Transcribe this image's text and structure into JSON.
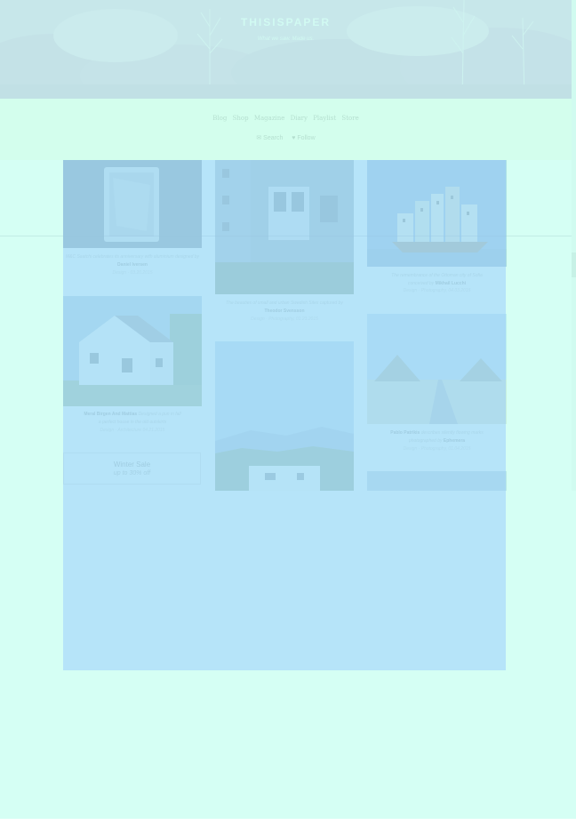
{
  "site": {
    "title": "THISISPAPER",
    "tagline": "What we saw. Made us."
  },
  "nav": {
    "links": [
      "Blog",
      "Shop",
      "Magazine",
      "Diary",
      "Playlist",
      "Store"
    ],
    "search_label": "✉ Search",
    "follow_label": "♥ Follow"
  },
  "posts": {
    "foil": {
      "caption_prefix": "M&C Saatchi celebrates its anniversary with aluminium",
      "caption_mid": "designed by",
      "author": "Daniel Iversen",
      "category": "Design",
      "date": "03.20.2015"
    },
    "building": {
      "caption_prefix": "The beauties of small and urban Swedish Sites captured by",
      "author": "Theodor Svensson",
      "category": "Design",
      "date": "Photography, 01.23.2015"
    },
    "ship": {
      "caption_prefix": "The remembrance of the Ottoman city of Sofia",
      "caption_mid": "conceived by",
      "author": "Mikhail Lucchi",
      "category": "Design",
      "date": "Photography, 04.03.2015"
    },
    "house": {
      "author": "Meral Birgen And Mattias",
      "caption_suffix": "Designed a pun in fall",
      "caption_line2": "a perfect house in the old outskirts",
      "category": "Design",
      "date": "Architecture 04.21.2015"
    },
    "pyramids": {
      "author": "Pablo Patrikis",
      "caption_suffix": "describes silently flowing marks",
      "caption_line2": "photographed by",
      "author2": "Ephemera",
      "category": "Design",
      "date": "Photography, 01.04.2015"
    }
  },
  "promo": {
    "title": "Winter Sale",
    "subtitle": "up to 30% off"
  },
  "colors": {
    "hero": "#c386cf",
    "navbar": "#fff8e2",
    "tint_mint": "#c8fff0",
    "tint_blue": "#8cbeff"
  }
}
